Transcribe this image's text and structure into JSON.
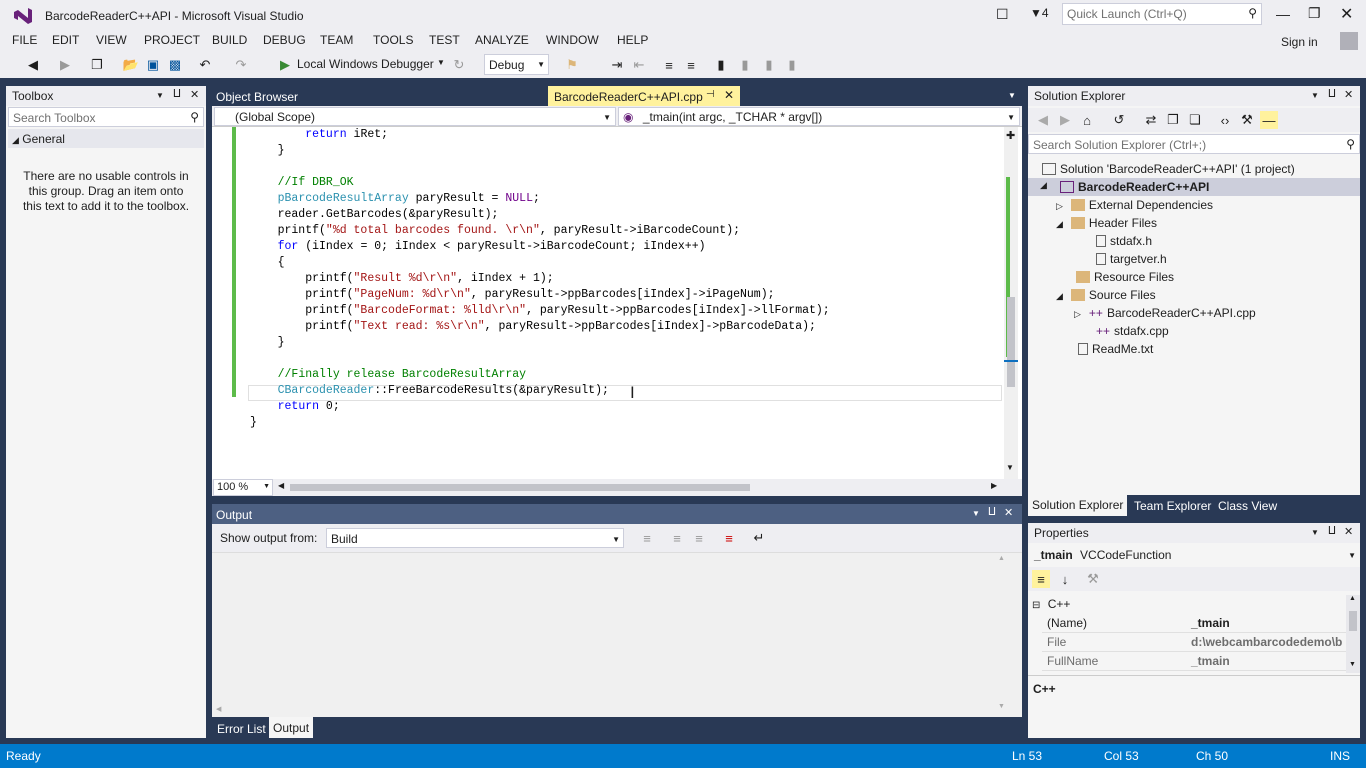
{
  "window": {
    "title": "BarcodeReaderC++API - Microsoft Visual Studio",
    "notification_count": "4",
    "quick_launch_placeholder": "Quick Launch (Ctrl+Q)",
    "sign_in": "Sign in"
  },
  "menu": [
    "FILE",
    "EDIT",
    "VIEW",
    "PROJECT",
    "BUILD",
    "DEBUG",
    "TEAM",
    "TOOLS",
    "TEST",
    "ANALYZE",
    "WINDOW",
    "HELP"
  ],
  "toolbar": {
    "debugger_label": "Local Windows Debugger",
    "config_value": "Debug"
  },
  "toolbox": {
    "title": "Toolbox",
    "search_placeholder": "Search Toolbox",
    "group": "General",
    "empty_message": "There are no usable controls in this group. Drag an item onto this text to add it to the toolbox."
  },
  "editor": {
    "tabs": [
      "Object Browser",
      "BarcodeReaderC++API.cpp"
    ],
    "scope": "(Global Scope)",
    "function": "_tmain(int argc, _TCHAR * argv[])",
    "zoom": "100 %"
  },
  "output": {
    "title": "Output",
    "show_from_label": "Show output from:",
    "source": "Build",
    "bottom_tabs": [
      "Error List",
      "Output"
    ]
  },
  "solution_explorer": {
    "title": "Solution Explorer",
    "search_placeholder": "Search Solution Explorer (Ctrl+;)",
    "solution": "Solution 'BarcodeReaderC++API' (1 project)",
    "project": "BarcodeReaderC++API",
    "items": [
      "External Dependencies",
      "Header Files",
      "stdafx.h",
      "targetver.h",
      "Resource Files",
      "Source Files",
      "BarcodeReaderC++API.cpp",
      "stdafx.cpp",
      "ReadMe.txt"
    ],
    "tabs": [
      "Solution Explorer",
      "Team Explorer",
      "Class View"
    ]
  },
  "properties": {
    "title": "Properties",
    "object_name": "_tmain",
    "object_type": "VCCodeFunction",
    "category": "C++",
    "rows": [
      {
        "name": "(Name)",
        "value": "_tmain"
      },
      {
        "name": "File",
        "value": "d:\\webcambarcodedemo\\b"
      },
      {
        "name": "FullName",
        "value": "_tmain"
      }
    ],
    "description": "C++"
  },
  "status": {
    "state": "Ready",
    "line": "Ln 53",
    "col": "Col 53",
    "ch": "Ch 50",
    "mode": "INS"
  },
  "colors": {
    "accent": "#007acc",
    "panel_header": "#4d6082",
    "active_tab": "#fff29d",
    "background": "#293955"
  }
}
